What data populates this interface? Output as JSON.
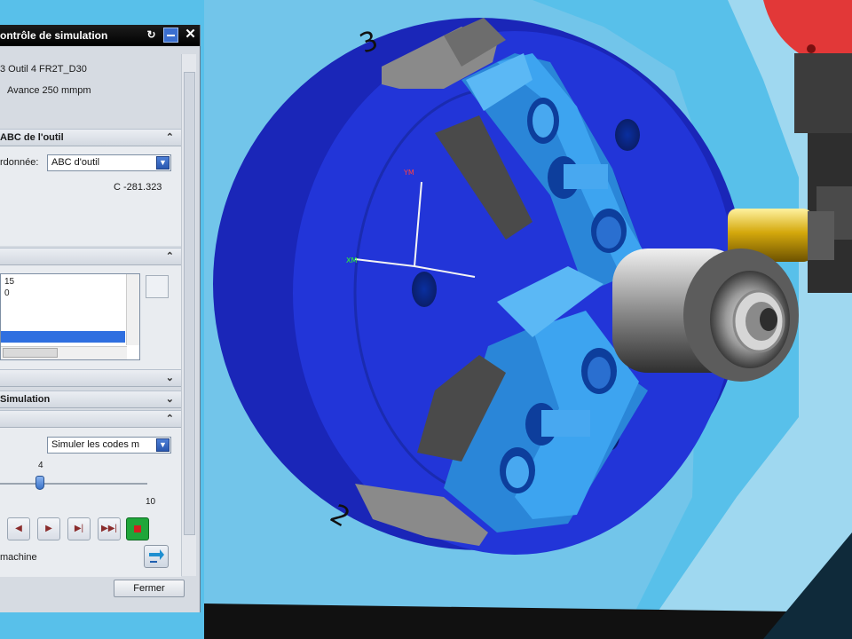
{
  "dialog": {
    "title": "ontrôle de simulation",
    "info_line1": "3  Outil 4   FR2T_D30",
    "info_line2": "Avance 250 mmpm",
    "section_tool": {
      "header": "ABC de l'outil",
      "coord_label": "rdonnée:",
      "coord_value": "ABC d'outil",
      "readout": "C -281.323"
    },
    "list": {
      "items": [
        "15",
        "0"
      ]
    },
    "section_simulation": {
      "header": "Simulation"
    },
    "sim_select": "Simuler les codes m",
    "slider": {
      "value": "4",
      "max": "10",
      "level": 0.4
    },
    "machine_label": "machine",
    "close_button": "Fermer"
  },
  "viewport": {
    "triad_y": "YM",
    "triad_x": "XM",
    "chuck_numbers": [
      "3",
      "2"
    ]
  }
}
